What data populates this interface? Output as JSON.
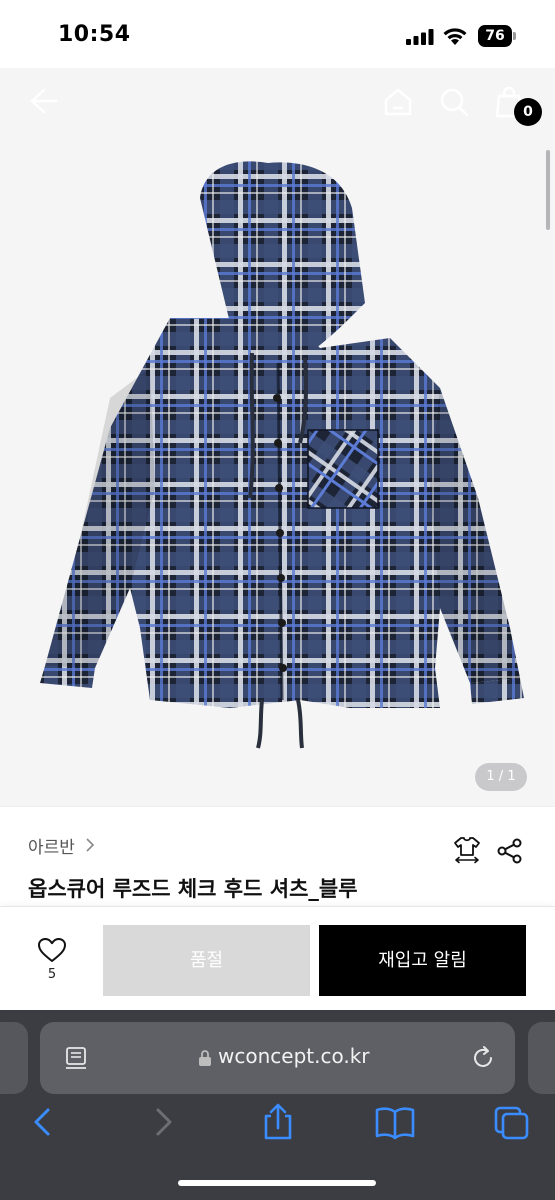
{
  "status_bar": {
    "time": "10:54",
    "battery": "76"
  },
  "header": {
    "cart_count": "0"
  },
  "gallery": {
    "counter": "1 / 1"
  },
  "product": {
    "brand": "아르반",
    "name": "옵스큐어 루즈드 체크 후드 셔츠_블루"
  },
  "actions": {
    "wish_count": "5",
    "soldout_label": "품절",
    "restock_label": "재입고 알림"
  },
  "browser": {
    "url": "wconcept.co.kr"
  },
  "colors": {
    "accent": "#000000",
    "soldout": "#d9d9d9",
    "safari_bar": "#3b3d43",
    "link_blue": "#3a8cff"
  }
}
